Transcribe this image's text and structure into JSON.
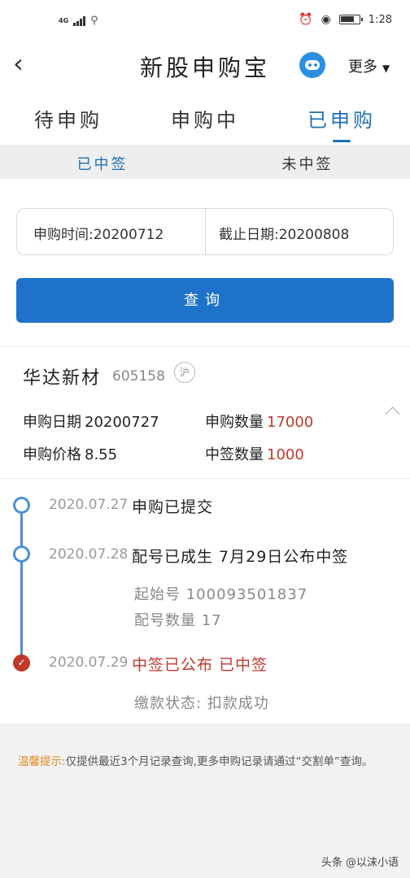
{
  "statusbar": {
    "network": "4G",
    "time": "1:28"
  },
  "header": {
    "title": "新股申购宝",
    "more_label": "更多",
    "more_arrow": "▼",
    "back_icon": "back-arrow-icon"
  },
  "tabs": [
    "待申购",
    "申购中",
    "已申购"
  ],
  "subtabs": [
    "已中签",
    "未中签"
  ],
  "query": {
    "start_label": "申购时间:",
    "start_value": "20200712",
    "end_label": "截止日期:",
    "end_value": "20200808",
    "button_label": "查询"
  },
  "stock": {
    "name": "华达新材",
    "code": "605158",
    "exchange": "沪",
    "apply_date_label": "申购日期",
    "apply_date": "20200727",
    "apply_qty_label": "申购数量",
    "apply_qty": "17000",
    "price_label": "申购价格",
    "price": "8.55",
    "win_qty_label": "中签数量",
    "win_qty": "1000"
  },
  "timeline": {
    "step1": {
      "date": "2020.07.27",
      "text": "申购已提交"
    },
    "step2": {
      "date": "2020.07.28",
      "text": "配号已成生 7月29日公布中签",
      "start_no": "起始号 100093501837",
      "count": "配号数量 17"
    },
    "step3": {
      "date": "2020.07.29",
      "text": "中签已公布 已中签",
      "payment": "缴款状态: 扣款成功"
    }
  },
  "tip": {
    "label": "温馨提示:",
    "text": "仅提供最近3个月记录查询,更多申购记录请通过“交割单”查询。"
  },
  "watermark": "头条 @以沫小语",
  "colors": {
    "accent": "#1f72c9",
    "active_tab": "#1f6fb2",
    "red": "#c0392b",
    "tip_label": "#e08a1e"
  }
}
